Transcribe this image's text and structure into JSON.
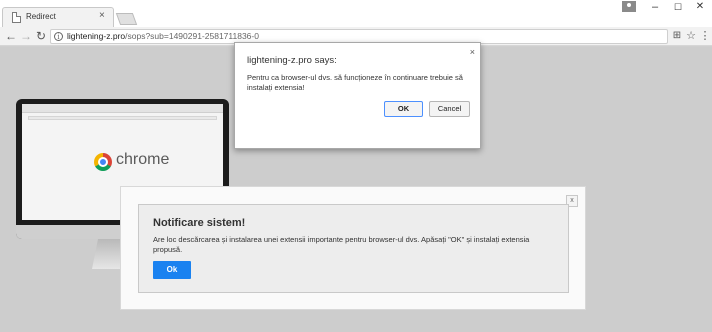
{
  "browser": {
    "tab_title": "Redirect",
    "tab_close": "×",
    "url_host": "lightening-z.pro",
    "url_path": "/sops?sub=1490291-2581711836-0",
    "window_minimize": "–",
    "window_maximize": "☐",
    "window_close": "✕",
    "icons": [
      "page-icon",
      "back-arrow-icon",
      "forward-arrow-icon",
      "reload-icon",
      "info-icon",
      "translate-icon",
      "star-icon",
      "menu-icon",
      "user-icon"
    ]
  },
  "background_art": {
    "brand_word": "chrome"
  },
  "alert": {
    "title": "lightening-z.pro says:",
    "message": "Pentru ca browser-ul dvs. să funcționeze în continuare trebuie să instalați extensia!",
    "ok_label": "OK",
    "cancel_label": "Cancel",
    "close_label": "×"
  },
  "notification": {
    "title": "Notificare sistem!",
    "message": "Are loc descărcarea și instalarea unei extensii importante pentru browser-ul dvs. Apăsați \"OK\" și instalați extensia propusă.",
    "button_label": "Ok",
    "close_label": "x",
    "colors": {
      "button": "#1a82f0"
    }
  }
}
